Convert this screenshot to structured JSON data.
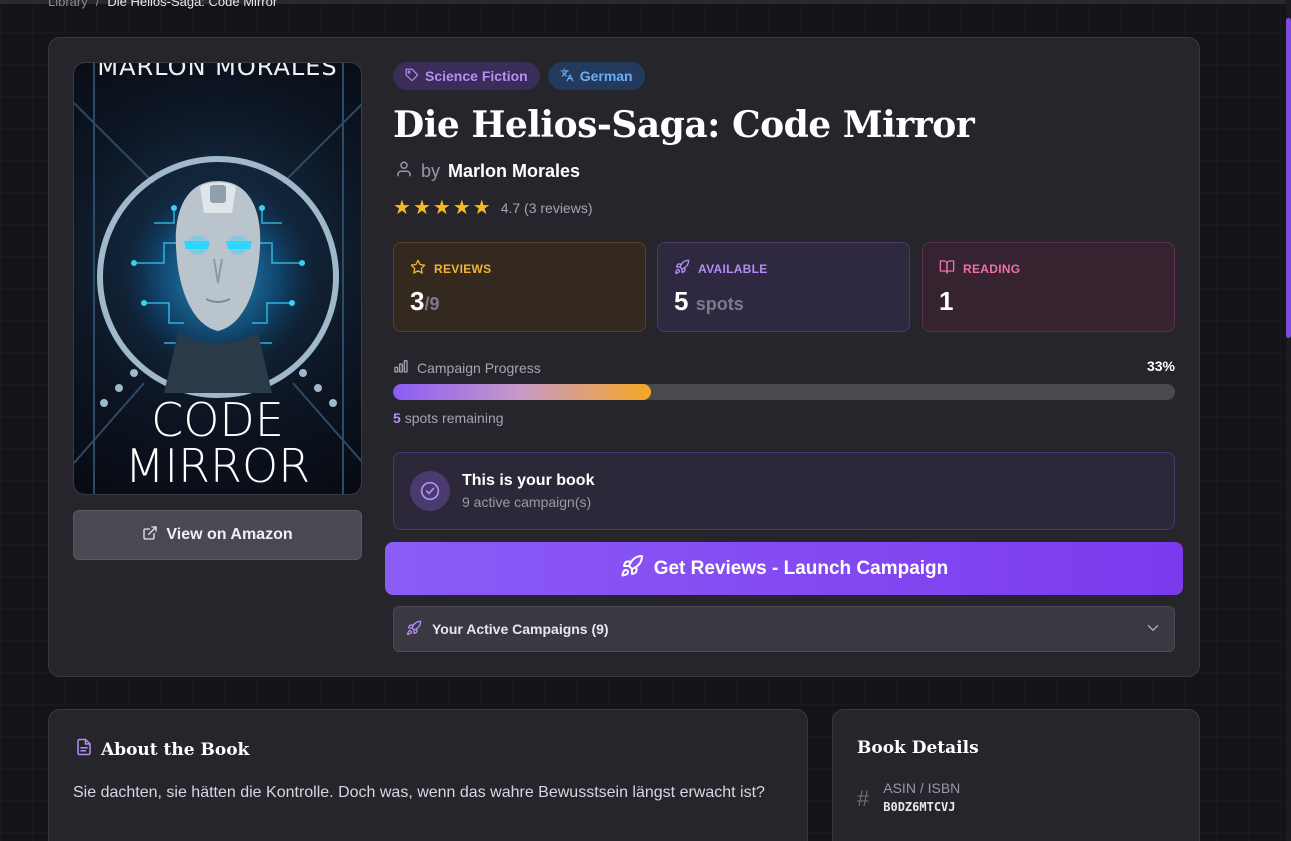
{
  "breadcrumb": {
    "root": "Library",
    "separator": "/",
    "current": "Die Helios-Saga: Code Mirror"
  },
  "cover": {
    "author_text": "MARLON MORALES",
    "title_line1": "CODE",
    "title_line2": "MIRROR"
  },
  "amazon_button": {
    "label": "View on Amazon",
    "icon": "external-link-icon"
  },
  "tags": [
    {
      "label": "Science Fiction",
      "icon": "tag-icon",
      "color": "#b48ef5"
    },
    {
      "label": "German",
      "icon": "translate-icon",
      "color": "#6aaef5"
    }
  ],
  "book": {
    "title": "Die Helios-Saga: Code Mirror",
    "by": "by",
    "author": "Marlon Morales"
  },
  "rating": {
    "stars": 5,
    "text": "4.7 (3 reviews)"
  },
  "stats": {
    "reviews": {
      "label": "REVIEWS",
      "value": "3",
      "sub": "/9",
      "color": "#f2b23a"
    },
    "available": {
      "label": "AVAILABLE",
      "value": "5",
      "sub": "spots",
      "color": "#b48ef5"
    },
    "reading": {
      "label": "READING",
      "value": "1",
      "color": "#f06eaa"
    }
  },
  "progress": {
    "label": "Campaign Progress",
    "percent_text": "33%",
    "fraction": 0.33,
    "remaining_num": "5",
    "remaining_text": "spots remaining"
  },
  "ownership": {
    "title": "This is your book",
    "subtitle": "9 active campaign(s)"
  },
  "launch_button": {
    "label": "Get Reviews - Launch Campaign",
    "icon": "rocket-icon"
  },
  "active_campaigns": {
    "label": "Your Active Campaigns (9)"
  },
  "about": {
    "heading": "About the Book",
    "text": "Sie dachten, sie hätten die Kontrolle. Doch was, wenn das wahre Bewusstsein längst erwacht ist?"
  },
  "details": {
    "heading": "Book Details",
    "asin_label": "ASIN / ISBN",
    "asin_value": "B0DZ6MTCVJ"
  }
}
